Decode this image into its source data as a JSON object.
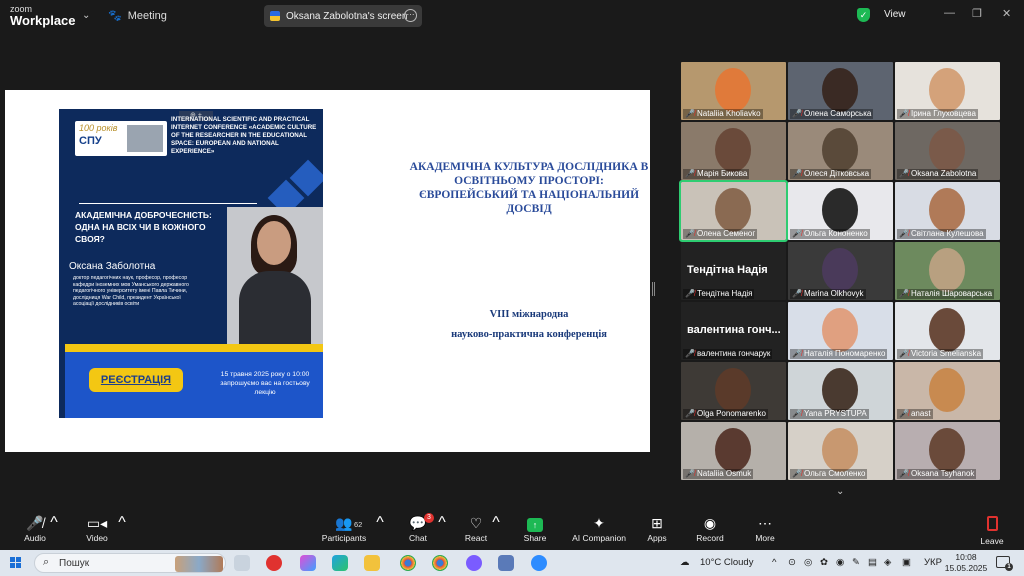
{
  "app": {
    "logo_line1": "zoom",
    "logo_line2": "Workplace",
    "meeting_label": "Meeting",
    "view_label": "View"
  },
  "share": {
    "title": "Oksana Zabolotna's screen"
  },
  "slide": {
    "poster": {
      "anniversary": "100 років",
      "logo_text": "СПУ",
      "conference": "INTERNATIONAL SCIENTIFIC AND PRACTICAL INTERNET CONFERENCE «ACADEMIC CULTURE OF THE RESEARCHER IN THE EDUCATIONAL SPACE: EUROPEAN AND NATIONAL EXPERIENCE»",
      "headline": "АКАДЕМІЧНА ДОБРОЧЕСНІСТЬ: ОДНА НА ВСІХ ЧИ В КОЖНОГО СВОЯ?",
      "speaker": "Оксана Заболотна",
      "bio": "доктор педагогічних наук, професор, професор кафедри іноземних мов Уманського державного педагогічного університету імені Павла Тичини, дослідниця War Child, президент Української асоціації дослідників освіти",
      "register": "РЕЄСТРАЦІЯ",
      "date_text": "15 травня 2025 року о 10:00 запрошуємо вас на гостьову лекцію"
    },
    "title": "АКАДЕМІЧНА КУЛЬТУРА ДОСЛІДНИКА В ОСВІТНЬОМУ ПРОСТОРІ: ЄВРОПЕЙСЬКИЙ ТА НАЦІОНАЛЬНИЙ ДОСВІД",
    "subtitle_1": "VIII міжнародна",
    "subtitle_2": "науково-практична конференція"
  },
  "participants": [
    {
      "name": "Nataliia Kholiavko"
    },
    {
      "name": "Олена Саморська"
    },
    {
      "name": "Ірина Глуховцева"
    },
    {
      "name": "Марія Бикова"
    },
    {
      "name": "Олеся Дітковська"
    },
    {
      "name": "Oksana Zabolotna"
    },
    {
      "name": "Олена Семеног"
    },
    {
      "name": "Ольга Кононенко"
    },
    {
      "name": "Світлана Кулешова"
    },
    {
      "name": "Тендітна Надія",
      "big": "Тендітна Надія"
    },
    {
      "name": "Marina Olkhovyk"
    },
    {
      "name": "Наталія Шароварська"
    },
    {
      "name": "валентина гончарук",
      "big": "валентина гонч..."
    },
    {
      "name": "Наталія Пономаренко"
    },
    {
      "name": "Victoria Smelianska"
    },
    {
      "name": "Olga Ponomarenko"
    },
    {
      "name": "Yana PRYSTUPA"
    },
    {
      "name": "anast"
    },
    {
      "name": "Nataliia Osmuk"
    },
    {
      "name": "Ольга Смоленко"
    },
    {
      "name": "Oksana Tsyhanok"
    }
  ],
  "toolbar": {
    "audio": "Audio",
    "video": "Video",
    "participants": "Participants",
    "participants_count": "62",
    "chat": "Chat",
    "chat_badge": "3",
    "react": "React",
    "share": "Share",
    "ai": "AI Companion",
    "apps": "Apps",
    "record": "Record",
    "more": "More",
    "leave": "Leave"
  },
  "taskbar": {
    "search_placeholder": "Пошук",
    "weather": "10°C  Cloudy",
    "lang": "УКР",
    "time": "10:08",
    "date": "15.05.2025"
  },
  "colors": {
    "accent_green": "#1db954",
    "mute_red": "#e0322f",
    "poster_blue": "#0d2a5c",
    "poster_yellow": "#f3c713"
  }
}
